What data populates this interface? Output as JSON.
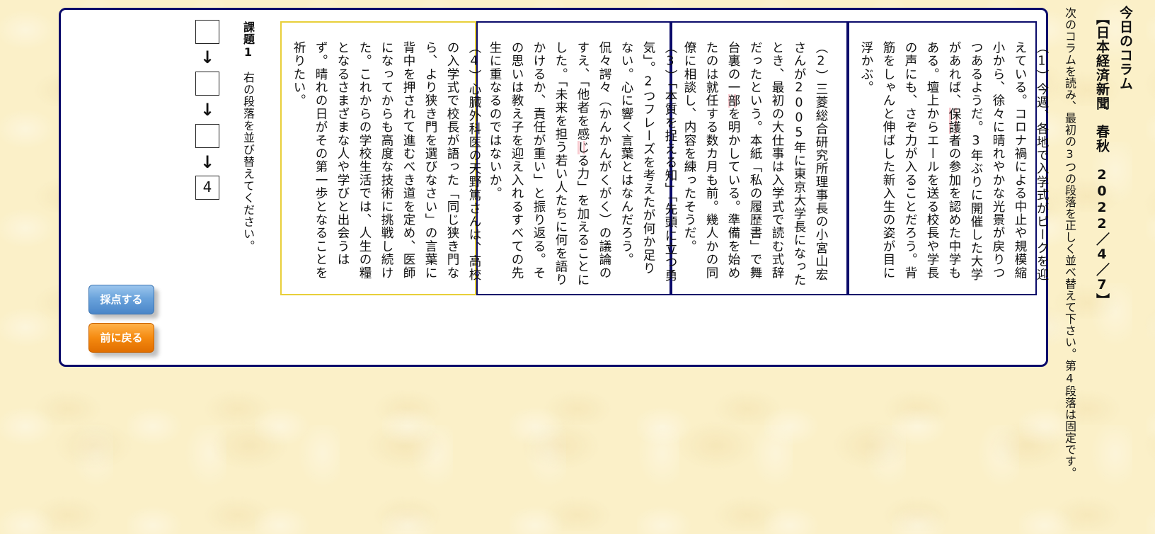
{
  "header": {
    "title": "今日のコラム",
    "source": "【日本経済新聞　春秋　2022／4／7】",
    "instruction": "次のコラムを読み、最初の3つの段落を正しく並べ替えて下さい。第4段落は固定です。"
  },
  "paragraphs": [
    {
      "id": "1",
      "before": "（1）今週、各地で入学式がピークを迎えている。コロナ禍による中止や規模縮小から、徐々に晴れやかな光景が戻りつつあるようだ。3年ぶりに開催した大学があれば、",
      "highlight": "保護",
      "after": "者の参加を認めた中学もある。壇上からエールを送る校長や学長の声にも、さぞ力が入ることだろう。背筋をしゃんと伸ばした新入生の姿が目に浮かぶ。"
    },
    {
      "id": "2",
      "before": "（2）三菱総合研究所理事長の小宮山宏さんが2005年に東京大学長になったとき、最初の大仕事は入学式で読む式辞だったという。本紙「私の履歴書」で舞台裏の一",
      "highlight": "部",
      "after": "を明かしている。準備を始めたのは就任する数カ月も前。幾人かの同僚に相談し、内容を練ったそうだ。"
    },
    {
      "id": "3",
      "before": "（3）「本質を捉える知」「先頭に立つ勇気」。2つフレーズを考えたが何か足りない。心に響く言葉とはなんだろう。侃々諤々（かんかんがくがく）の議論のすえ、「他者を感",
      "highlight": "じ",
      "after": "る力」を加えることにした。「未来を担う若い人たちに何を語りかけるか、責任が重い」と振り返る。その思いは教え子を迎え入れるすべての先生に重なるのではないか。"
    },
    {
      "id": "4",
      "before": "（4）心臓外科医の天野篤さんは、高校の入学式で校長が語った「同じ狭き門なら、より狭き門を選びなさい」の言葉に背中を押されて進むべき道を定め、医師になってからも高度な技術に挑戦し続けた。これからの学校生活では、人生の糧となるさまざまな人や学びと出会うはず。晴れの日がその第一歩となることを祈りたい。",
      "highlight": "",
      "after": ""
    }
  ],
  "task": {
    "label_bold": "課題1",
    "label_text": "右の段落を並び替えてください。",
    "arrow": "↓",
    "slots": [
      "",
      "",
      "",
      "4"
    ]
  },
  "buttons": {
    "score": "採点する",
    "back": "前に戻る"
  },
  "colors": {
    "frame_border": "#0a0a6a",
    "fixed_paragraph_border": "#e8cf3a",
    "score_button": "#5b95d4",
    "back_button": "#f08010",
    "background": "#fbf0c8"
  }
}
